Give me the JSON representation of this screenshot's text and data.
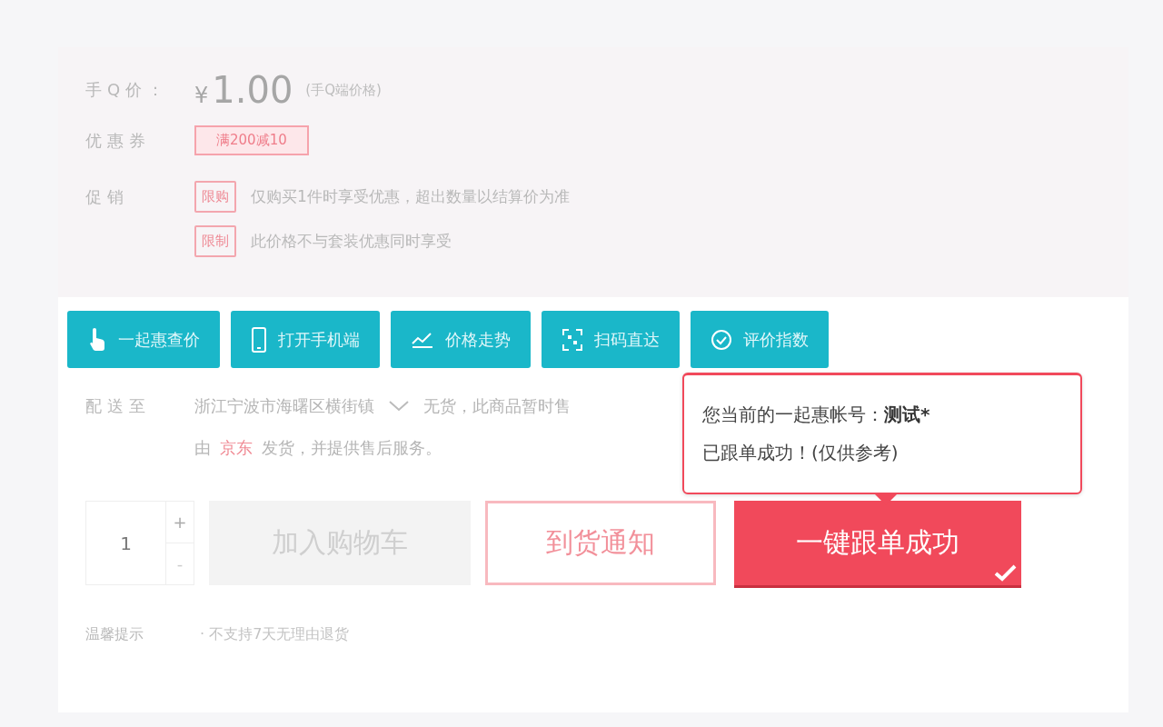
{
  "price": {
    "label": "手Q价：",
    "currency": "¥",
    "value": "1.00",
    "note": "(手Q端价格)"
  },
  "coupon": {
    "label": "优惠券",
    "tags": [
      "满200减10"
    ]
  },
  "promotion": {
    "label": "促销",
    "items": [
      {
        "tag": "限购",
        "text": "仅购买1件时享受优惠，超出数量以结算价为准"
      },
      {
        "tag": "限制",
        "text": "此价格不与套装优惠同时享受"
      }
    ]
  },
  "tools": [
    {
      "kind": "hand",
      "label": "一起惠查价"
    },
    {
      "kind": "phone",
      "label": "打开手机端"
    },
    {
      "kind": "trend",
      "label": "价格走势"
    },
    {
      "kind": "scan",
      "label": "扫码直达"
    },
    {
      "kind": "rating",
      "label": "评价指数"
    }
  ],
  "delivery": {
    "label": "配送至",
    "address": "浙江宁波市海曙区横街镇",
    "stock": "无货，此商品暂时售",
    "by": "由",
    "seller": "京东",
    "service": "发货，并提供售后服务。"
  },
  "purchase": {
    "quantity": "1",
    "plus": "+",
    "minus": "-",
    "buttons": [
      {
        "kind": "disabled",
        "label": "加入购物车"
      },
      {
        "kind": "outline",
        "label": "到货通知"
      },
      {
        "kind": "primary",
        "label": "一键跟单成功",
        "checked": true
      }
    ]
  },
  "popup": {
    "prefix": "您当前的一起惠帐号：",
    "account": "测试*",
    "message": "已跟单成功！(仅供参考)"
  },
  "tip": {
    "label": "温馨提示",
    "text": "· 不支持7天无理由退货"
  }
}
